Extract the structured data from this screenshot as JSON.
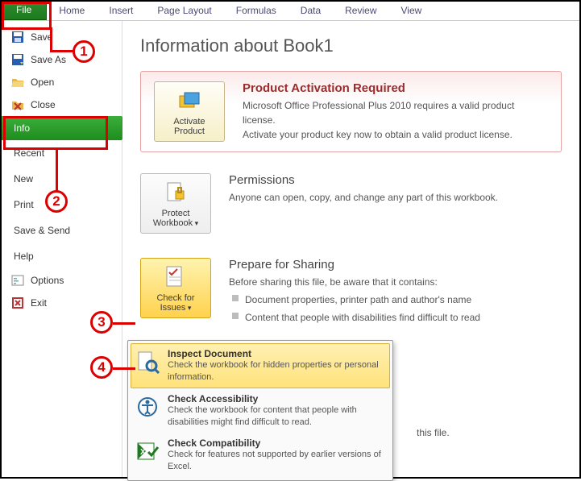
{
  "ribbon": {
    "file": "File",
    "tabs": [
      "Home",
      "Insert",
      "Page Layout",
      "Formulas",
      "Data",
      "Review",
      "View"
    ]
  },
  "leftnav": {
    "save": "Save",
    "save_as": "Save As",
    "open": "Open",
    "close": "Close",
    "info": "Info",
    "recent": "Recent",
    "new": "New",
    "print": "Print",
    "save_send": "Save & Send",
    "help": "Help",
    "options": "Options",
    "exit": "Exit"
  },
  "page": {
    "title": "Information about Book1"
  },
  "activation": {
    "title": "Product Activation Required",
    "line1": "Microsoft Office Professional Plus 2010 requires a valid product license.",
    "line2": "Activate your product key now to obtain a valid product license.",
    "button": "Activate Product"
  },
  "permissions": {
    "title": "Permissions",
    "body": "Anyone can open, copy, and change any part of this workbook.",
    "button": "Protect Workbook"
  },
  "prepare": {
    "title": "Prepare for Sharing",
    "lead": "Before sharing this file, be aware that it contains:",
    "item1": "Document properties, printer path and author's name",
    "item2": "Content that people with disabilities find difficult to read",
    "button": "Check for Issues"
  },
  "versions_tail": "this file.",
  "flyout": {
    "inspect": {
      "title": "Inspect Document",
      "desc": "Check the workbook for hidden properties or personal information."
    },
    "access": {
      "title": "Check Accessibility",
      "desc": "Check the workbook for content that people with disabilities might find difficult to read."
    },
    "compat": {
      "title": "Check Compatibility",
      "desc": "Check for features not supported by earlier versions of Excel."
    }
  },
  "markers": {
    "m1": "1",
    "m2": "2",
    "m3": "3",
    "m4": "4"
  }
}
